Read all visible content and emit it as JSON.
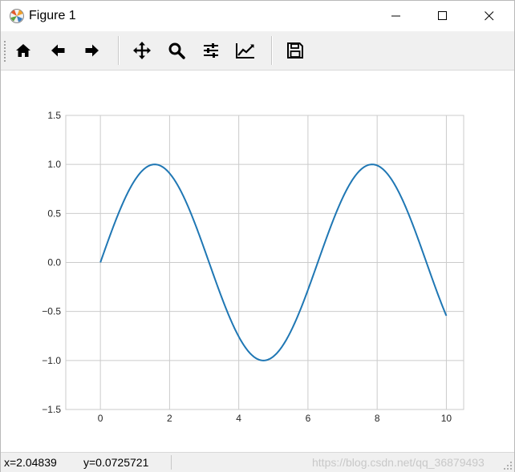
{
  "window": {
    "title": "Figure 1"
  },
  "toolbar": {
    "buttons": [
      {
        "name": "home-icon"
      },
      {
        "name": "back-arrow-icon"
      },
      {
        "name": "forward-arrow-icon"
      },
      {
        "name": "pan-move-icon"
      },
      {
        "name": "zoom-magnifier-icon"
      },
      {
        "name": "subplots-sliders-icon"
      },
      {
        "name": "edit-axis-icon"
      },
      {
        "name": "save-floppy-icon"
      }
    ]
  },
  "status": {
    "x_readout": "x=2.04839",
    "y_readout": "y=0.0725721",
    "watermark": "https://blog.csdn.net/qq_36879493"
  },
  "colors": {
    "line": "#1f77b4",
    "grid": "#cbcbcb",
    "toolbar": "#f0f0f0"
  },
  "chart_data": {
    "type": "line",
    "function": "sin(x)",
    "series": [
      {
        "x": [
          0,
          0.25,
          0.5,
          0.75,
          1,
          1.25,
          1.5,
          1.75,
          2,
          2.25,
          2.5,
          2.75,
          3,
          3.25,
          3.5,
          3.75,
          4,
          4.25,
          4.5,
          4.75,
          5,
          5.25,
          5.5,
          5.75,
          6,
          6.25,
          6.5,
          6.75,
          7,
          7.25,
          7.5,
          7.75,
          8,
          8.25,
          8.5,
          8.75,
          9,
          9.25,
          9.5,
          9.75,
          10
        ],
        "y": [
          0,
          0.247,
          0.479,
          0.682,
          0.841,
          0.949,
          0.997,
          0.984,
          0.909,
          0.778,
          0.598,
          0.382,
          0.141,
          -0.108,
          -0.351,
          -0.572,
          -0.757,
          -0.895,
          -0.978,
          -0.999,
          -0.959,
          -0.859,
          -0.706,
          -0.508,
          -0.279,
          -0.033,
          0.215,
          0.451,
          0.657,
          0.823,
          0.938,
          0.994,
          0.989,
          0.923,
          0.798,
          0.625,
          0.412,
          0.174,
          -0.075,
          -0.319,
          -0.544
        ]
      }
    ],
    "xlim": [
      -1,
      10.5
    ],
    "ylim": [
      -1.5,
      1.5
    ],
    "xticks": [
      0,
      2,
      4,
      6,
      8,
      10
    ],
    "yticks": [
      1.5,
      1.0,
      0.5,
      0.0,
      -0.5,
      -1.0,
      -1.5
    ],
    "xtick_labels": [
      "0",
      "2",
      "4",
      "6",
      "8",
      "10"
    ],
    "ytick_labels": [
      "1.5",
      "1.0",
      "0.5",
      "0.0",
      "−0.5",
      "−1.0",
      "−1.5"
    ],
    "grid": true,
    "title": "",
    "xlabel": "",
    "ylabel": ""
  }
}
